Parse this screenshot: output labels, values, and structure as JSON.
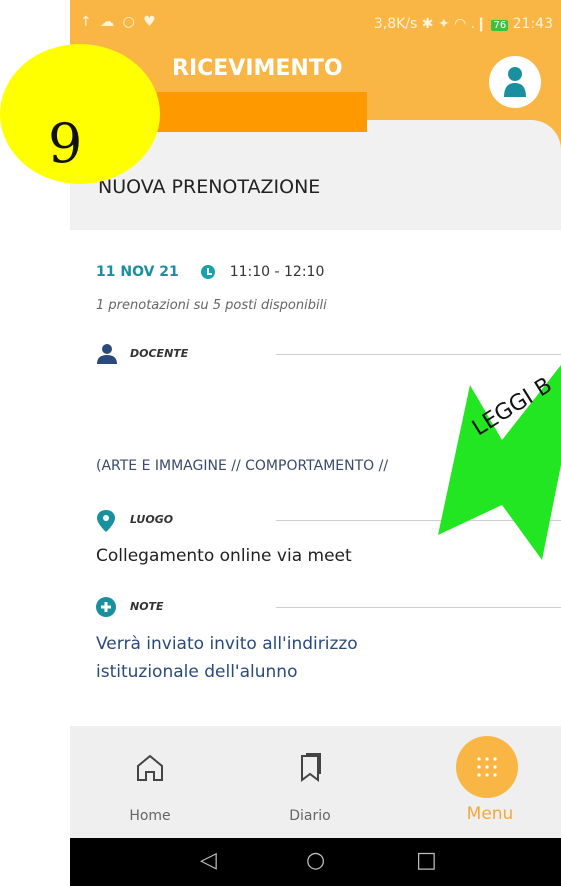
{
  "status_bar": {
    "left_icons": "↑ ☁ ○ ♥",
    "network_speed": "3,8K/s",
    "battery": "76",
    "time": "21:43"
  },
  "header": {
    "title": "RICEVIMENTO"
  },
  "section": {
    "title": "NUOVA PRENOTAZIONE"
  },
  "appointment": {
    "date": "11 NOV 21",
    "time": "11:10 - 12:10",
    "availability": "1 prenotazioni su 5 posti disponibili"
  },
  "fields": {
    "teacher_label": "DOCENTE",
    "subjects": "(ARTE E IMMAGINE // COMPORTAMENTO //",
    "place_label": "LUOGO",
    "place_value": "Collegamento online via meet",
    "note_label": "NOTE",
    "note_value": "Verrà  inviato invito all'indirizzo istituzionale dell'alunno"
  },
  "annotation": {
    "badge_number": "9",
    "arrow_text": "LEGGI B"
  },
  "tabbar": {
    "home": "Home",
    "diario": "Diario",
    "menu": "Menu"
  },
  "colors": {
    "header": "#f9b645",
    "accent": "#1a8fa0",
    "arrow": "#22e622",
    "badge": "#ffff00",
    "redaction": "#ff9900"
  }
}
